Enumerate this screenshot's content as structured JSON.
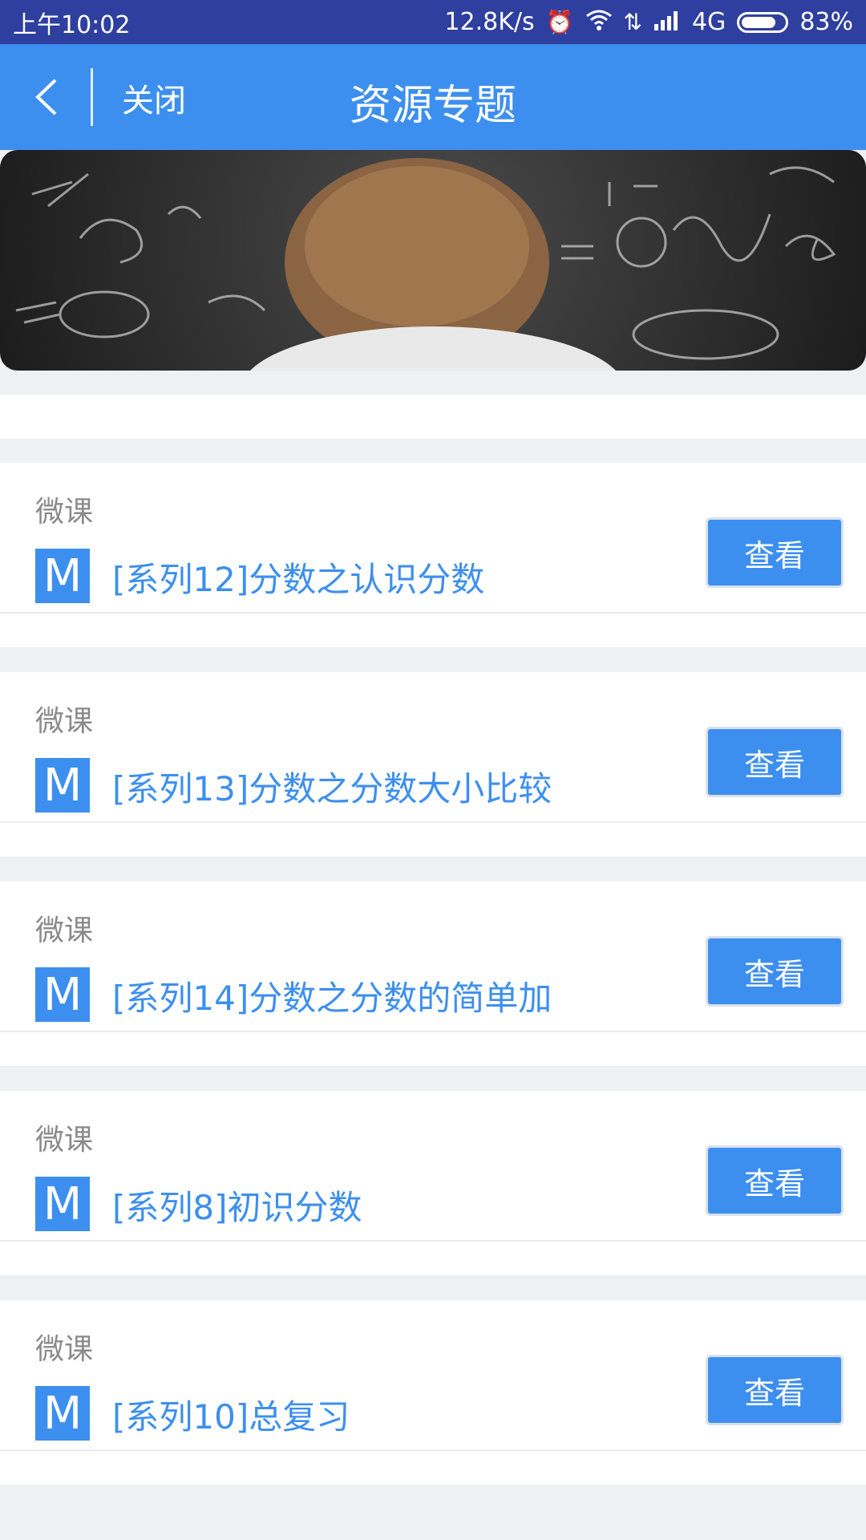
{
  "status_bar": {
    "time": "上午10:02",
    "network_speed": "12.8K/s",
    "network_type": "4G",
    "battery": "83%",
    "battery_level": 0.83
  },
  "app_bar": {
    "close_label": "关闭",
    "title": "资源专题"
  },
  "colors": {
    "accent": "#3d8fef",
    "status_bar": "#2f3f9f",
    "type_text": "#8a8a8a"
  },
  "items": [
    {
      "type": "微课",
      "icon": "M",
      "title": "[系列12]分数之认识分数",
      "button": "查看"
    },
    {
      "type": "微课",
      "icon": "M",
      "title": "[系列13]分数之分数大小比较",
      "button": "查看"
    },
    {
      "type": "微课",
      "icon": "M",
      "title": "[系列14]分数之分数的简单加",
      "button": "查看"
    },
    {
      "type": "微课",
      "icon": "M",
      "title": "[系列8]初识分数",
      "button": "查看"
    },
    {
      "type": "微课",
      "icon": "M",
      "title": "[系列10]总复习",
      "button": "查看"
    }
  ]
}
